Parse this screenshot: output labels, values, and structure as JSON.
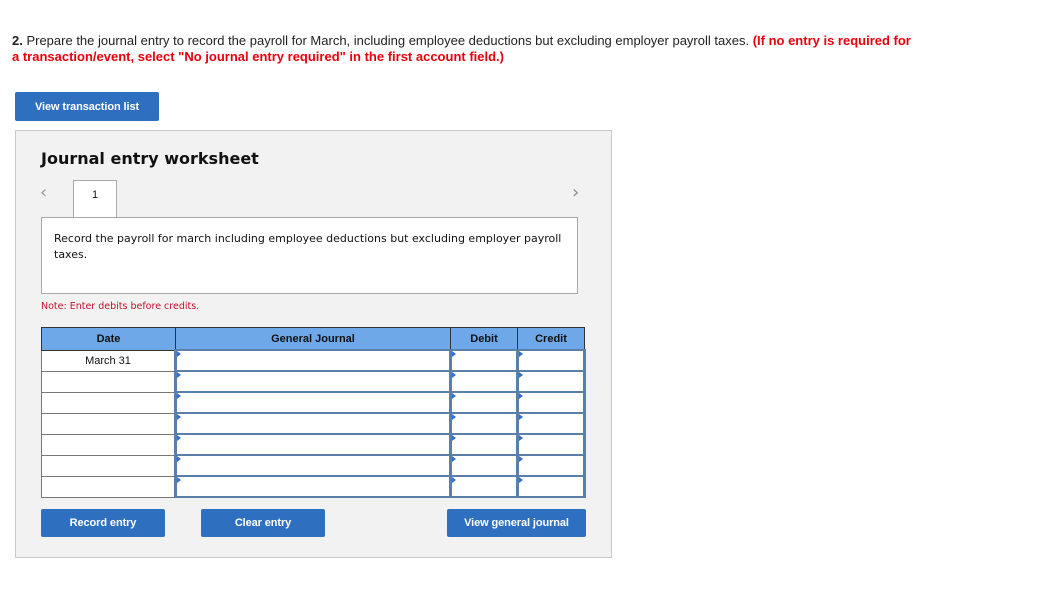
{
  "question": {
    "number": "2.",
    "text": " Prepare the journal entry to record the payroll for March, including employee deductions but excluding employer payroll taxes. ",
    "instruction": "(If no entry is required for a transaction/event, select \"No journal entry required\" in the first account field.)"
  },
  "buttons": {
    "view_transaction_list": "View transaction list",
    "record_entry": "Record entry",
    "clear_entry": "Clear entry",
    "view_general_journal": "View general journal"
  },
  "worksheet": {
    "title": "Journal entry worksheet",
    "prev_icon": "‹",
    "next_icon": "›",
    "tab_label": "1",
    "description": "Record the payroll for march including employee deductions but excluding employer payroll taxes.",
    "note": "Note: Enter debits before credits.",
    "table": {
      "headers": [
        "Date",
        "General Journal",
        "Debit",
        "Credit"
      ],
      "rows": [
        {
          "date": "March 31",
          "account": "",
          "debit": "",
          "credit": ""
        },
        {
          "date": "",
          "account": "",
          "debit": "",
          "credit": ""
        },
        {
          "date": "",
          "account": "",
          "debit": "",
          "credit": ""
        },
        {
          "date": "",
          "account": "",
          "debit": "",
          "credit": ""
        },
        {
          "date": "",
          "account": "",
          "debit": "",
          "credit": ""
        },
        {
          "date": "",
          "account": "",
          "debit": "",
          "credit": ""
        },
        {
          "date": "",
          "account": "",
          "debit": "",
          "credit": ""
        }
      ]
    }
  },
  "colors": {
    "button_blue": "#2f6fbf",
    "header_blue": "#6fa8e8",
    "instruction_red": "#e8000b",
    "note_red": "#c8102e"
  }
}
